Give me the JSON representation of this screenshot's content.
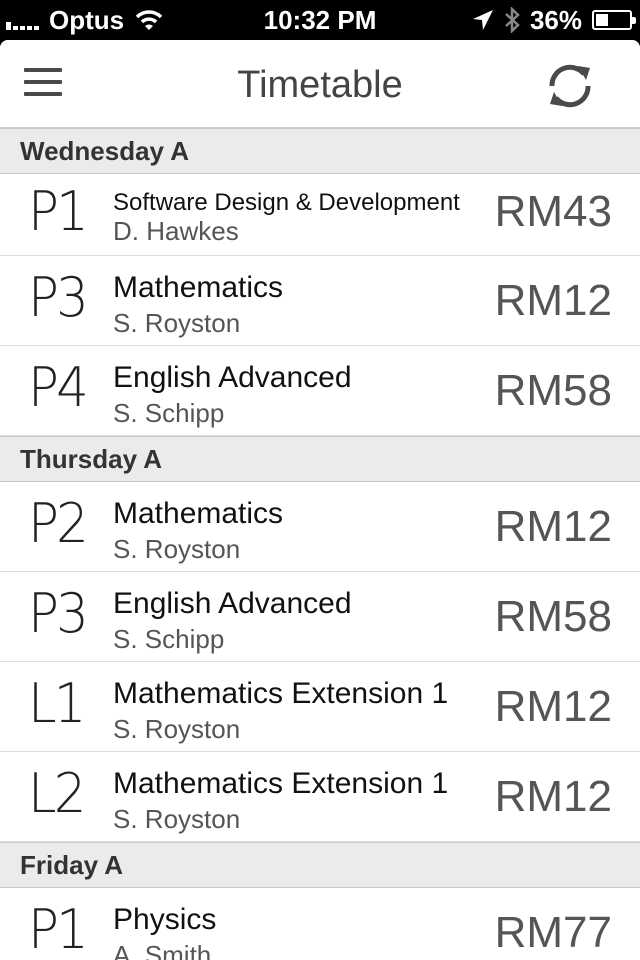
{
  "status_bar": {
    "carrier": "Optus",
    "time": "10:32 PM",
    "battery": "36%",
    "battery_level": 0.36
  },
  "navbar": {
    "title": "Timetable",
    "menu_icon": "hamburger-menu-icon",
    "refresh_icon": "refresh-icon"
  },
  "days": [
    {
      "name": "Wednesday A",
      "classes": [
        {
          "period": "P1",
          "subject": "Software Design & Development",
          "teacher": "D. Hawkes",
          "room": "RM43"
        },
        {
          "period": "P3",
          "subject": "Mathematics",
          "teacher": "S. Royston",
          "room": "RM12"
        },
        {
          "period": "P4",
          "subject": "English Advanced",
          "teacher": "S. Schipp",
          "room": "RM58"
        }
      ]
    },
    {
      "name": "Thursday A",
      "classes": [
        {
          "period": "P2",
          "subject": "Mathematics",
          "teacher": "S. Royston",
          "room": "RM12"
        },
        {
          "period": "P3",
          "subject": "English Advanced",
          "teacher": "S. Schipp",
          "room": "RM58"
        },
        {
          "period": "L1",
          "subject": "Mathematics Extension 1",
          "teacher": "S. Royston",
          "room": "RM12"
        },
        {
          "period": "L2",
          "subject": "Mathematics Extension 1",
          "teacher": "S. Royston",
          "room": "RM12"
        }
      ]
    },
    {
      "name": "Friday A",
      "classes": [
        {
          "period": "P1",
          "subject": "Physics",
          "teacher": "A. Smith",
          "room": "RM77"
        }
      ]
    }
  ]
}
